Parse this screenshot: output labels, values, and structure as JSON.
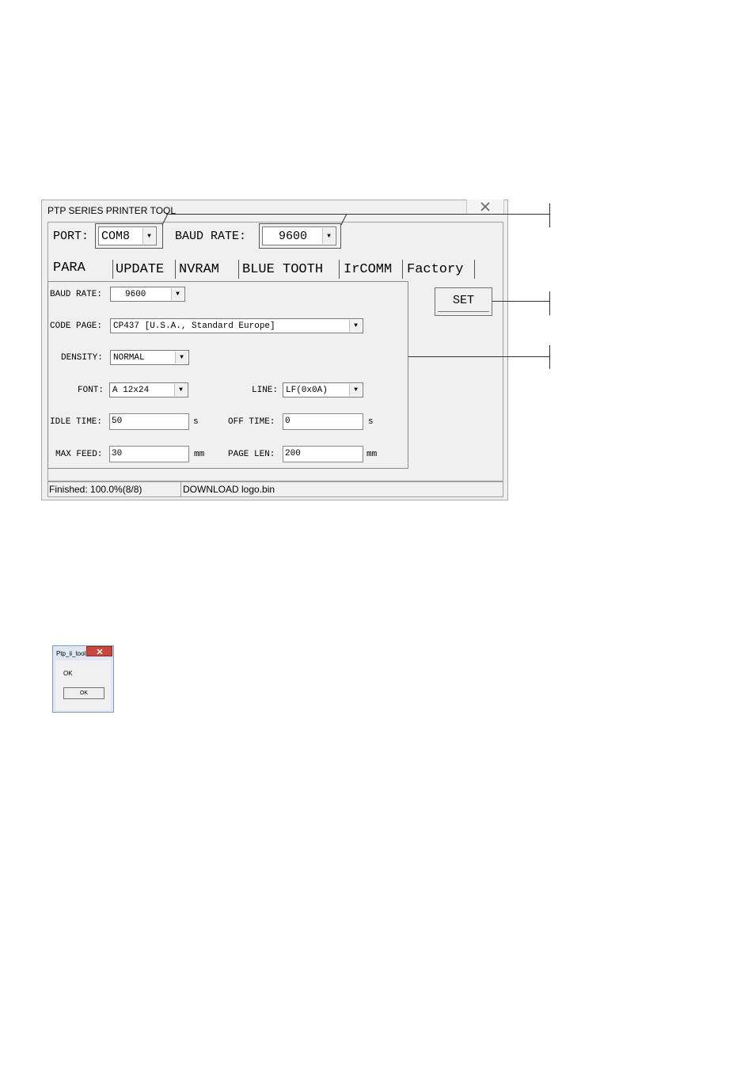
{
  "window": {
    "title": "PTP SERIES PRINTER TOOL"
  },
  "connection": {
    "port_label": "PORT:",
    "port_value": "COM8",
    "baud_label": "BAUD RATE:",
    "baud_value": "9600"
  },
  "tabs": [
    {
      "label": "PARA"
    },
    {
      "label": "UPDATE"
    },
    {
      "label": "NVRAM"
    },
    {
      "label": "BLUE TOOTH"
    },
    {
      "label": "IrCOMM"
    },
    {
      "label": "Factory"
    }
  ],
  "para": {
    "baud_rate": {
      "label": "BAUD RATE:",
      "value": "9600"
    },
    "code_page": {
      "label": "CODE PAGE:",
      "value": "CP437 [U.S.A., Standard Europe]"
    },
    "density": {
      "label": "DENSITY:",
      "value": "NORMAL"
    },
    "font": {
      "label": "FONT:",
      "value": "A 12x24"
    },
    "line": {
      "label": "LINE:",
      "value": "LF(0x0A)"
    },
    "idle_time": {
      "label": "IDLE TIME:",
      "value": "50",
      "unit": "s"
    },
    "off_time": {
      "label": "OFF TIME:",
      "value": "0",
      "unit": "s"
    },
    "max_feed": {
      "label": "MAX FEED:",
      "value": "30",
      "unit": "mm"
    },
    "page_len": {
      "label": "PAGE LEN:",
      "value": "200",
      "unit": "mm"
    }
  },
  "set_button": {
    "label": "SET"
  },
  "status": {
    "progress_text": "Finished: 100.0%(8/8)",
    "message": "DOWNLOAD logo.bin"
  },
  "dialog": {
    "title": "Ptp_ii_tool",
    "message": "OK",
    "ok_label": "OK"
  }
}
